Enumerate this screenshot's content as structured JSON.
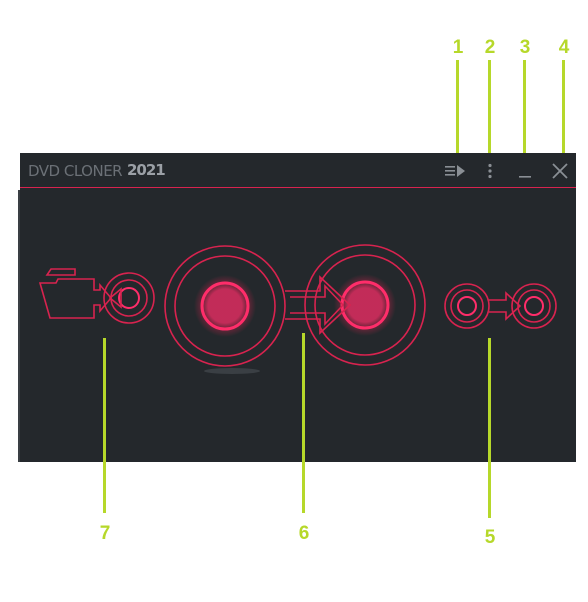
{
  "app": {
    "title": "DVD CLONER",
    "year": "2021"
  },
  "titlebar": {
    "icons": [
      "queue-play-icon",
      "more-vert-icon",
      "minimize-icon",
      "close-icon"
    ]
  },
  "functions": [
    {
      "id": "video-converter",
      "icon": "camera-converter-icon"
    },
    {
      "id": "main-clone",
      "icon": "main-clone-icon"
    },
    {
      "id": "extra-tools",
      "icon": "mini-clone-icon"
    }
  ],
  "callouts": [
    "1",
    "2",
    "3",
    "4",
    "5",
    "6",
    "7"
  ],
  "colors": {
    "callout": "#b6d82a",
    "accent": "#d8234f",
    "background": "#24282c"
  }
}
